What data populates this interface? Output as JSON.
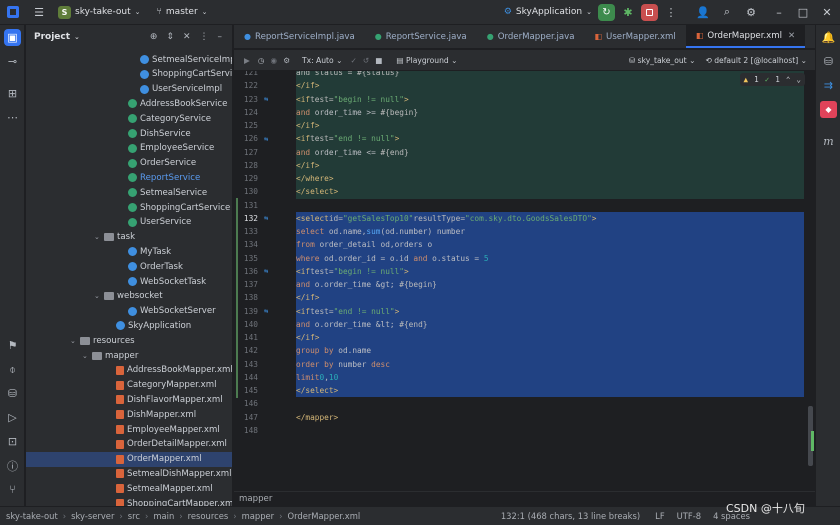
{
  "titlebar": {
    "project_badge": "S",
    "project": "sky-take-out",
    "branch": "master",
    "run_config": "SkyApplication"
  },
  "project_panel": {
    "title": "Project"
  },
  "tree": [
    {
      "label": "SetmealServiceImpl",
      "icon": "c",
      "indent": 140
    },
    {
      "label": "ShoppingCartServiceImpl",
      "icon": "c",
      "indent": 140
    },
    {
      "label": "UserServiceImpl",
      "icon": "c",
      "indent": 140
    },
    {
      "label": "AddressBookService",
      "icon": "i",
      "indent": 128
    },
    {
      "label": "CategoryService",
      "icon": "i",
      "indent": 128
    },
    {
      "label": "DishService",
      "icon": "i",
      "indent": 128
    },
    {
      "label": "EmployeeService",
      "icon": "i",
      "indent": 128
    },
    {
      "label": "OrderService",
      "icon": "i",
      "indent": 128
    },
    {
      "label": "ReportService",
      "icon": "i",
      "indent": 128,
      "hl": true
    },
    {
      "label": "SetmealService",
      "icon": "i",
      "indent": 128
    },
    {
      "label": "ShoppingCartService",
      "icon": "i",
      "indent": 128
    },
    {
      "label": "UserService",
      "icon": "i",
      "indent": 128
    },
    {
      "label": "task",
      "icon": "f",
      "indent": 104,
      "arrow": "v"
    },
    {
      "label": "MyTask",
      "icon": "c",
      "indent": 128
    },
    {
      "label": "OrderTask",
      "icon": "c",
      "indent": 128
    },
    {
      "label": "WebSocketTask",
      "icon": "c",
      "indent": 128
    },
    {
      "label": "websocket",
      "icon": "f",
      "indent": 104,
      "arrow": "v"
    },
    {
      "label": "WebSocketServer",
      "icon": "c",
      "indent": 128
    },
    {
      "label": "SkyApplication",
      "icon": "c",
      "indent": 116
    },
    {
      "label": "resources",
      "icon": "f",
      "indent": 80,
      "arrow": "v"
    },
    {
      "label": "mapper",
      "icon": "f",
      "indent": 92,
      "arrow": "v"
    },
    {
      "label": "AddressBookMapper.xml",
      "icon": "x",
      "indent": 116
    },
    {
      "label": "CategoryMapper.xml",
      "icon": "x",
      "indent": 116
    },
    {
      "label": "DishFlavorMapper.xml",
      "icon": "x",
      "indent": 116
    },
    {
      "label": "DishMapper.xml",
      "icon": "x",
      "indent": 116
    },
    {
      "label": "EmployeeMapper.xml",
      "icon": "x",
      "indent": 116
    },
    {
      "label": "OrderDetailMapper.xml",
      "icon": "x",
      "indent": 116
    },
    {
      "label": "OrderMapper.xml",
      "icon": "x",
      "indent": 116,
      "sel": true
    },
    {
      "label": "SetmealDishMapper.xml",
      "icon": "x",
      "indent": 116
    },
    {
      "label": "SetmealMapper.xml",
      "icon": "x",
      "indent": 116
    },
    {
      "label": "ShoppingCartMapper.xml",
      "icon": "x",
      "indent": 116
    }
  ],
  "tabs": [
    {
      "label": "ReportServiceImpl.java",
      "icon": "c",
      "active": false
    },
    {
      "label": "ReportService.java",
      "icon": "i",
      "active": false
    },
    {
      "label": "OrderMapper.java",
      "icon": "i",
      "active": false
    },
    {
      "label": "UserMapper.xml",
      "icon": "x",
      "active": false
    },
    {
      "label": "OrderMapper.xml",
      "icon": "x",
      "active": true
    }
  ],
  "editor_toolbar": {
    "tx": "Tx: Auto",
    "playground": "Playground",
    "datasource": "sky_take_out",
    "session": "default 2 [@localhost]",
    "warnings": "1",
    "checks": "1"
  },
  "code_lines": [
    {
      "n": "121",
      "html": "            <span class='a'>and status = #{status}</span>",
      "bg": "sql"
    },
    {
      "n": "122",
      "html": "        <span class='t'>&lt;/if&gt;</span>",
      "bg": "sql"
    },
    {
      "n": "123",
      "html": "        <span class='t'>&lt;if</span> <span class='a'>test=</span><span class='s'>\"begin != null\"</span><span class='t'>&gt;</span>",
      "bg": "sql",
      "g": true
    },
    {
      "n": "124",
      "html": "            <span class='k'>and</span> order_time &gt;= <span class='a'>#{begin}</span>",
      "bg": "sql"
    },
    {
      "n": "125",
      "html": "        <span class='t'>&lt;/if&gt;</span>",
      "bg": "sql"
    },
    {
      "n": "126",
      "html": "        <span class='t'>&lt;if</span> <span class='a'>test=</span><span class='s'>\"end != null\"</span><span class='t'>&gt;</span>",
      "bg": "sql",
      "g": true
    },
    {
      "n": "127",
      "html": "            <span class='k'>and</span> order_time &lt;= <span class='a'>#{end}</span>",
      "bg": "sql"
    },
    {
      "n": "128",
      "html": "        <span class='t'>&lt;/if&gt;</span>",
      "bg": "sql"
    },
    {
      "n": "129",
      "html": "    <span class='t'>&lt;/where&gt;</span>",
      "bg": "sql"
    },
    {
      "n": "130",
      "html": "<span class='t'>&lt;/select&gt;</span>",
      "bg": "sql"
    },
    {
      "n": "131",
      "html": "",
      "bg": ""
    },
    {
      "n": "132",
      "html": "<span class='t'>&lt;select</span> <span class='a'>id=</span><span class='s'>\"getSalesTop10\"</span> <span class='a'>resultType=</span><span class='s'>\"com.sky.dto.GoodsSalesDTO\"</span><span class='t'>&gt;</span>",
      "bg": "hl",
      "g": true
    },
    {
      "n": "133",
      "html": "    <span class='k'>select</span> od.name,<span class='fn'>sum</span>(od.number) number",
      "bg": "hl"
    },
    {
      "n": "134",
      "html": "    <span class='k'>from</span> order_detail od,orders o",
      "bg": "hl"
    },
    {
      "n": "135",
      "html": "    <span class='k'>where</span> od.order_id = o.id <span class='k'>and</span> o.status = <span class='n'>5</span>",
      "bg": "hl"
    },
    {
      "n": "136",
      "html": "    <span class='t'>&lt;if</span> <span class='a'>test=</span><span class='s'>\"begin != null\"</span><span class='t'>&gt;</span>",
      "bg": "hl",
      "g": true
    },
    {
      "n": "137",
      "html": "        <span class='k'>and</span> o.order_time &amp;gt; <span class='a'>#{begin}</span>",
      "bg": "hl"
    },
    {
      "n": "138",
      "html": "    <span class='t'>&lt;/if&gt;</span>",
      "bg": "hl"
    },
    {
      "n": "139",
      "html": "    <span class='t'>&lt;if</span> <span class='a'>test=</span><span class='s'>\"end != null\"</span><span class='t'>&gt;</span>",
      "bg": "hl",
      "g": true
    },
    {
      "n": "140",
      "html": "        <span class='k'>and</span> o.order_time &amp;lt; <span class='a'>#{end}</span>",
      "bg": "hl"
    },
    {
      "n": "141",
      "html": "    <span class='t'>&lt;/if&gt;</span>",
      "bg": "hl"
    },
    {
      "n": "142",
      "html": "    <span class='k'>group by</span> od.name",
      "bg": "hl"
    },
    {
      "n": "143",
      "html": "    <span class='k'>order by</span> number <span class='k'>desc</span>",
      "bg": "hl"
    },
    {
      "n": "144",
      "html": "    <span class='k'>limit</span> <span class='n'>0</span>,<span class='n'>10</span>",
      "bg": "hl"
    },
    {
      "n": "145",
      "html": "<span class='t'>&lt;/select&gt;</span>",
      "bg": "hl"
    },
    {
      "n": "146",
      "html": "",
      "bg": ""
    },
    {
      "n": "147",
      "html": "<span class='t'>&lt;/mapper&gt;</span>",
      "bg": ""
    },
    {
      "n": "148",
      "html": "",
      "bg": ""
    }
  ],
  "breadcrumb_bottom": "mapper",
  "statusbar": {
    "path": [
      "sky-take-out",
      "sky-server",
      "src",
      "main",
      "resources",
      "mapper",
      "OrderMapper.xml"
    ],
    "position": "132:1 (468 chars, 13 line breaks)",
    "line_sep": "LF",
    "encoding": "UTF-8",
    "indent": "4 spaces"
  },
  "watermark": "CSDN @十八旬"
}
